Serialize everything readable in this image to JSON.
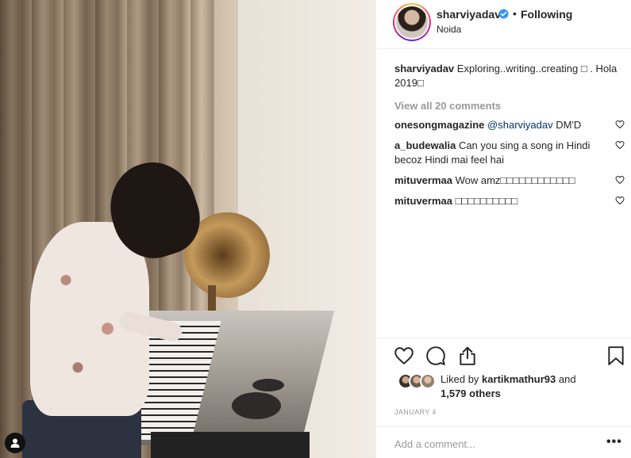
{
  "post": {
    "username": "sharviyadav",
    "dot": "•",
    "follow_status": "Following",
    "location": "Noida",
    "caption_text": "Exploring..writing..creating □ . Hola 2019□",
    "view_all_comments": "View all 20 comments",
    "comments": [
      {
        "user": "onesongmagazine",
        "mention": "@sharviyadav",
        "text": " DM'D"
      },
      {
        "user": "a_budewalia",
        "mention": "",
        "text": "Can you sing a song in Hindi becoz Hindi mai feel hai"
      },
      {
        "user": "mituvermaa",
        "mention": "",
        "text": "Wow amz□□□□□□□□□□□□"
      },
      {
        "user": "mituvermaa",
        "mention": "",
        "text": "□□□□□□□□□□"
      }
    ],
    "likes": {
      "prefix": "Liked by",
      "user": "kartikmathur93",
      "and": "and",
      "others": "1,579 others"
    },
    "date": "JANUARY 4",
    "add_comment_placeholder": "Add a comment...",
    "more_label": "•••"
  },
  "icons": {
    "like": "heart-icon",
    "comment": "comment-bubble-icon",
    "share": "share-icon",
    "save": "bookmark-icon",
    "verified": "verified-badge-icon",
    "user_tag": "user-icon"
  },
  "colors": {
    "text": "#262626",
    "muted": "#999999",
    "mention": "#003569",
    "verified": "#3897f0",
    "border": "#efefef"
  }
}
